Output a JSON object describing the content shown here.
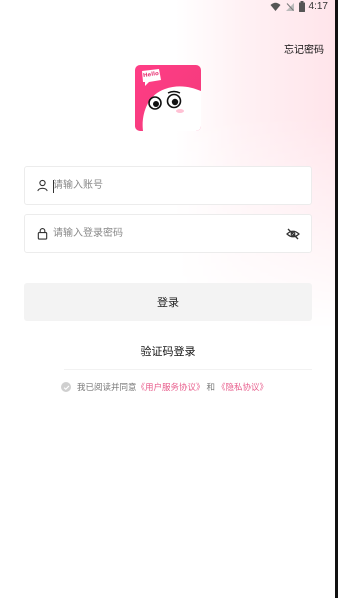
{
  "status_bar": {
    "time": "4:17",
    "icons": [
      "wifi-icon",
      "signal-icon",
      "battery-icon"
    ]
  },
  "header": {
    "forgot_password": "忘记密码"
  },
  "logo": {
    "badge_text": "Hello"
  },
  "form": {
    "account_placeholder": "请输入账号",
    "account_value": "",
    "password_placeholder": "请输入登录密码",
    "password_value": "",
    "login_button": "登录",
    "sms_login": "验证码登录"
  },
  "agreement": {
    "prefix": "我已阅读并同意",
    "user_agreement": "《用户服务协议》",
    "conjunction": "和",
    "privacy_policy": "《隐私协议》",
    "checked": false
  },
  "colors": {
    "brand": "#f0417d",
    "link": "#e85d8c",
    "button_bg": "#f3f3f3"
  }
}
